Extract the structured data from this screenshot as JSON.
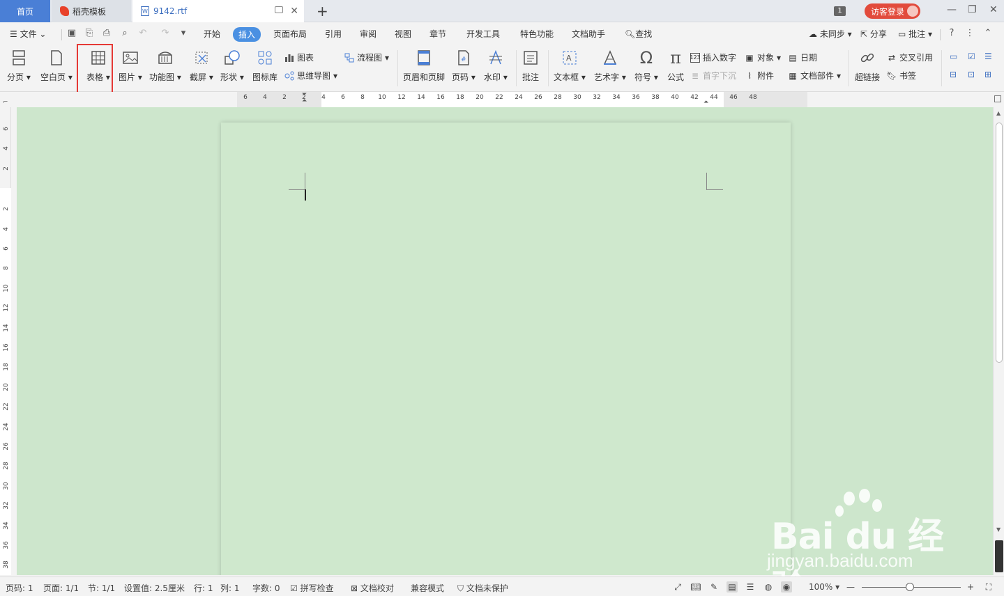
{
  "tabs": {
    "home": "首页",
    "daoke": "稻壳模板",
    "doc": "9142.rtf"
  },
  "titlebar": {
    "count": "1",
    "guest_login": "访客登录"
  },
  "menu": {
    "file": "文件",
    "items": [
      "开始",
      "插入",
      "页面布局",
      "引用",
      "审阅",
      "视图",
      "章节",
      "开发工具",
      "特色功能",
      "文档助手"
    ],
    "active": "插入",
    "search": "查找",
    "sync": "未同步",
    "share": "分享",
    "comment": "批注"
  },
  "ribbon": {
    "page_break": "分页",
    "blank_page": "空白页",
    "table": "表格",
    "picture": "图片",
    "function_chart": "功能图",
    "screenshot": "截屏",
    "shape": "形状",
    "icon_lib": "图标库",
    "chart": "图表",
    "mindmap": "思维导图",
    "flowchart": "流程图",
    "header_footer": "页眉和页脚",
    "page_number": "页码",
    "watermark": "水印",
    "annotation": "批注",
    "textbox": "文本框",
    "wordart": "艺术字",
    "symbol": "符号",
    "formula": "公式",
    "insert_number": "插入数字",
    "first_drop": "首字下沉",
    "object": "对象",
    "attachment": "附件",
    "date": "日期",
    "doc_parts": "文档部件",
    "hyperlink": "超链接",
    "cross_ref": "交叉引用",
    "bookmark": "书签"
  },
  "ruler": {
    "h_ticks": [
      "6",
      "4",
      "2",
      "2",
      "4",
      "6",
      "8",
      "10",
      "12",
      "14",
      "16",
      "18",
      "20",
      "22",
      "24",
      "26",
      "28",
      "30",
      "32",
      "34",
      "36",
      "38",
      "40",
      "42",
      "44",
      "46",
      "48"
    ],
    "v_ticks": [
      "6",
      "4",
      "2",
      "2",
      "4",
      "6",
      "8",
      "10",
      "12",
      "14",
      "16",
      "18",
      "20",
      "22",
      "24",
      "26",
      "28",
      "30",
      "32",
      "34",
      "36",
      "38"
    ]
  },
  "status": {
    "page_num": "页码: 1",
    "pages": "页面: 1/1",
    "section": "节: 1/1",
    "setting": "设置值: 2.5厘米",
    "row": "行: 1",
    "col": "列: 1",
    "word_count": "字数: 0",
    "spell_check": "拼写检查",
    "proofread": "文档校对",
    "compat_mode": "兼容模式",
    "unprotected": "文档未保护",
    "zoom": "100%"
  },
  "watermark": {
    "brand": "Bai du 经验",
    "url": "jingyan.baidu.com"
  },
  "colors": {
    "accent": "#4a90e2",
    "page_bg": "#cfe8cd",
    "highlight": "#e53935",
    "guest": "#e24b3c"
  }
}
